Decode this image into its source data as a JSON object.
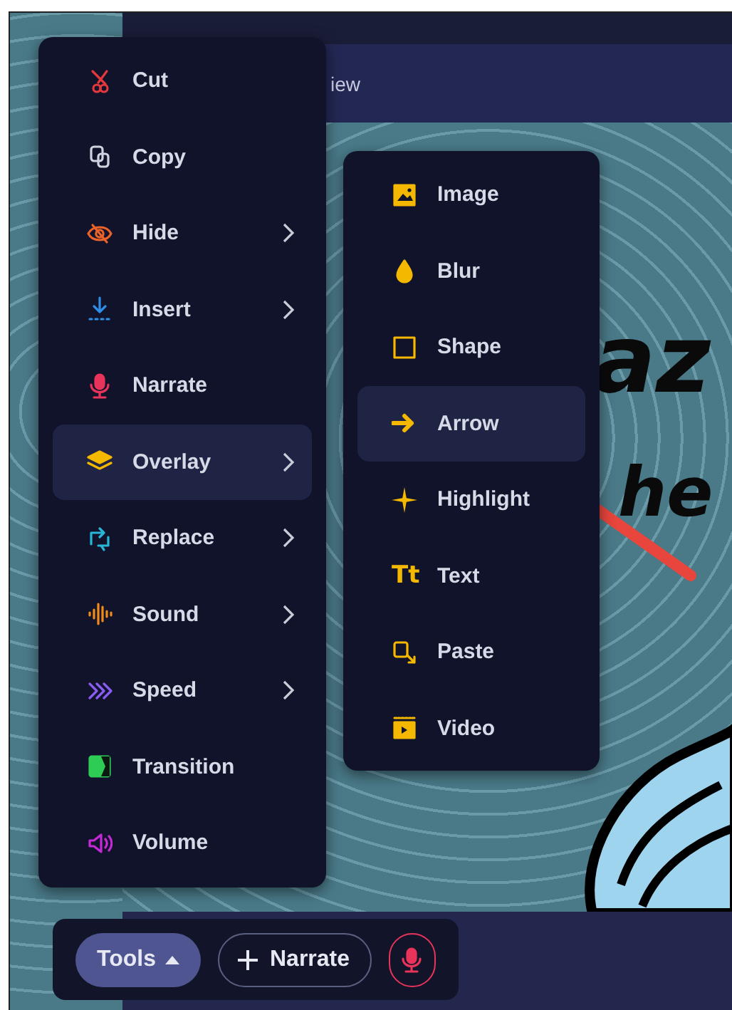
{
  "header": {
    "tab_label": "iew"
  },
  "slide": {
    "texts": [
      "az",
      "he"
    ]
  },
  "context_menu": {
    "items": [
      {
        "label": "Cut",
        "has_submenu": false,
        "selected": false
      },
      {
        "label": "Copy",
        "has_submenu": false,
        "selected": false
      },
      {
        "label": "Hide",
        "has_submenu": true,
        "selected": false
      },
      {
        "label": "Insert",
        "has_submenu": true,
        "selected": false
      },
      {
        "label": "Narrate",
        "has_submenu": false,
        "selected": false
      },
      {
        "label": "Overlay",
        "has_submenu": true,
        "selected": true
      },
      {
        "label": "Replace",
        "has_submenu": true,
        "selected": false
      },
      {
        "label": "Sound",
        "has_submenu": true,
        "selected": false
      },
      {
        "label": "Speed",
        "has_submenu": true,
        "selected": false
      },
      {
        "label": "Transition",
        "has_submenu": false,
        "selected": false
      },
      {
        "label": "Volume",
        "has_submenu": false,
        "selected": false
      }
    ]
  },
  "submenu": {
    "items": [
      {
        "label": "Image",
        "selected": false
      },
      {
        "label": "Blur",
        "selected": false
      },
      {
        "label": "Shape",
        "selected": false
      },
      {
        "label": "Arrow",
        "selected": true
      },
      {
        "label": "Highlight",
        "selected": false
      },
      {
        "label": "Text",
        "glyph": "Tt",
        "selected": false
      },
      {
        "label": "Paste",
        "selected": false
      },
      {
        "label": "Video",
        "selected": false
      }
    ]
  },
  "toolbar": {
    "buttons": [
      {
        "kind": "pill",
        "label": "Tools",
        "selected": true
      },
      {
        "kind": "outline",
        "label": "Narrate",
        "selected": false
      },
      {
        "kind": "mic",
        "selected": false
      }
    ]
  }
}
